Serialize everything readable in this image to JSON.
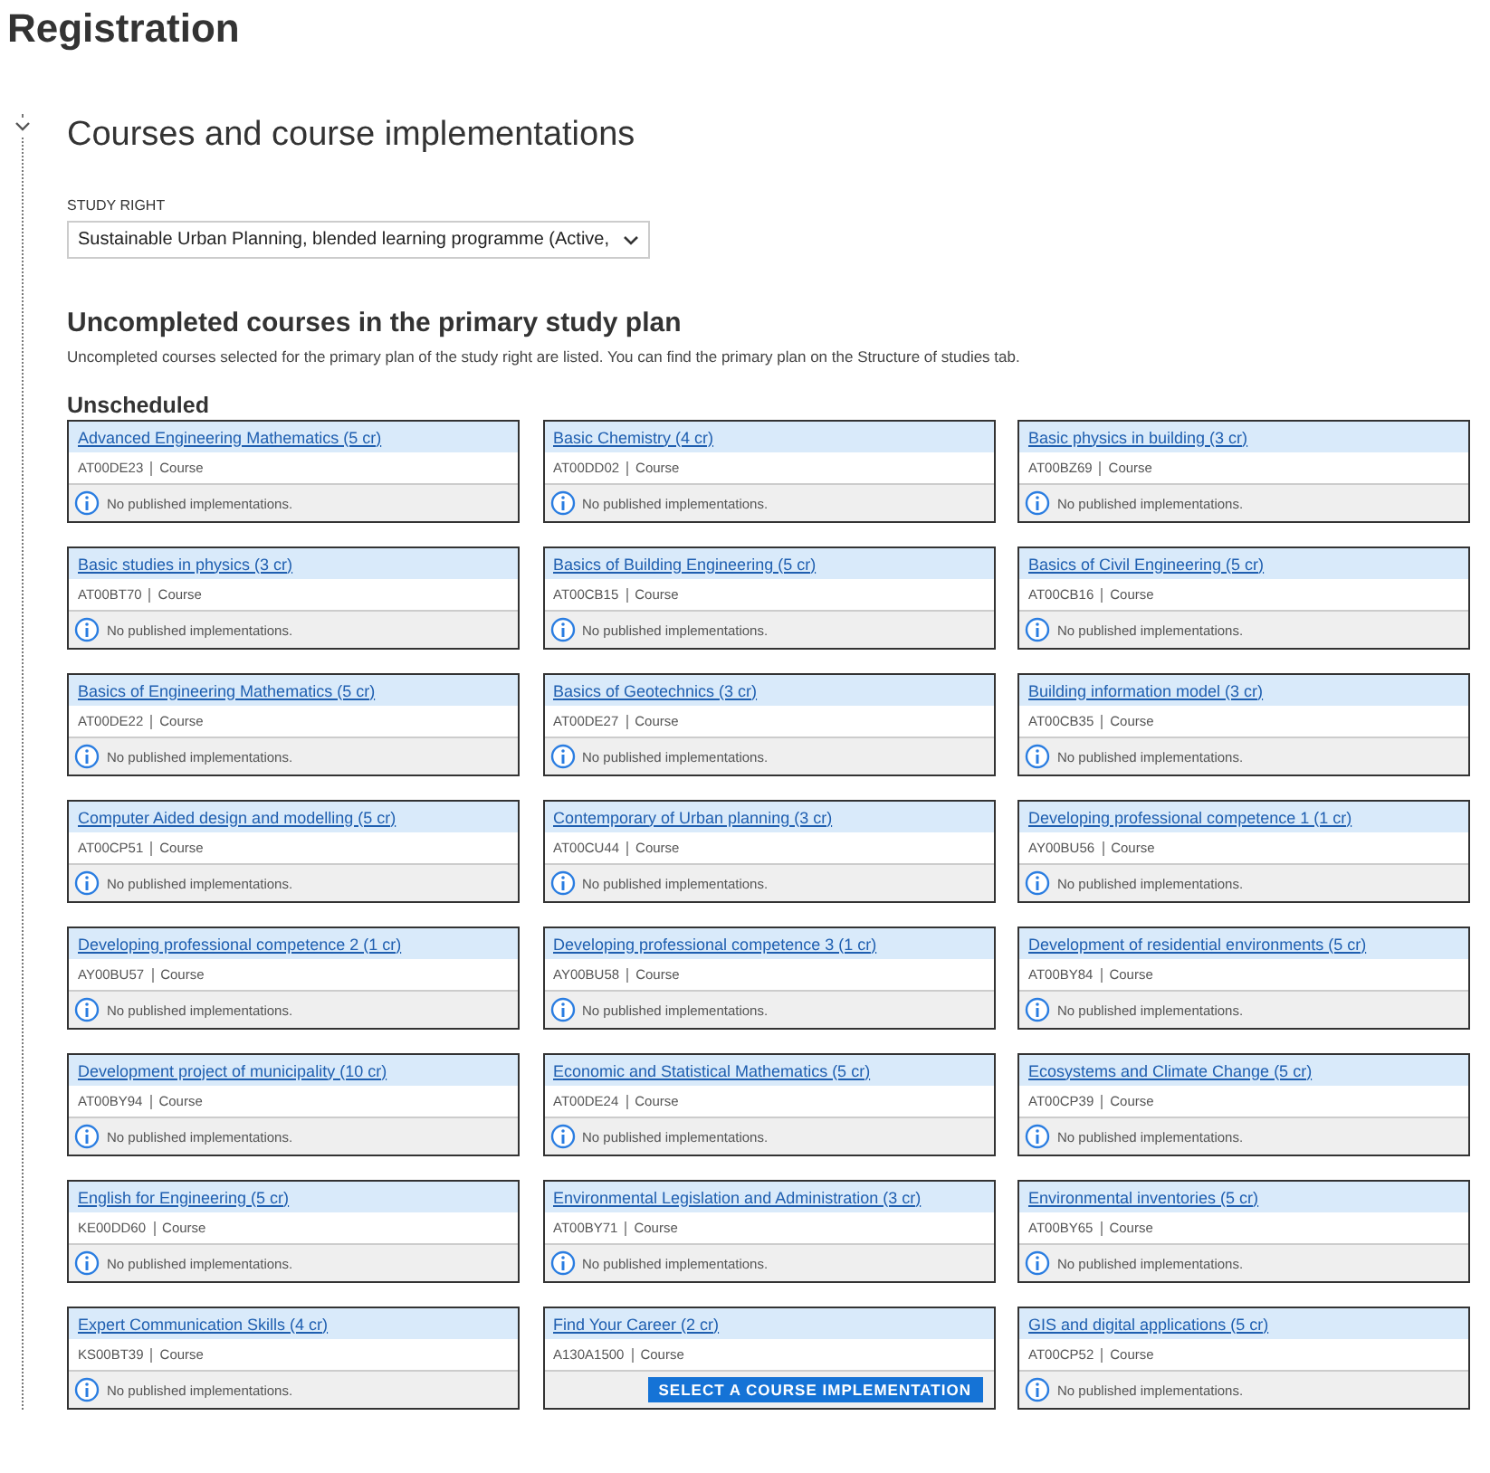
{
  "page_title": "Registration",
  "section": {
    "title": "Courses and course implementations",
    "expanded": true
  },
  "study_right": {
    "label": "STUDY RIGHT",
    "value": "Sustainable Urban Planning, blended learning programme (Active,"
  },
  "plan": {
    "title": "Uncompleted courses in the primary study plan",
    "description": "Uncompleted courses selected for the primary plan of the study right are listed. You can find the primary plan on the Structure of studies tab.",
    "group": "Unscheduled"
  },
  "courses": [
    {
      "title": "Advanced Engineering Mathematics (5 cr)",
      "code": "AT00DE23",
      "type": "Course",
      "kind": "info",
      "footer": "No published implementations."
    },
    {
      "title": "Basic Chemistry (4 cr)",
      "code": "AT00DD02",
      "type": "Course",
      "kind": "info",
      "footer": "No published implementations."
    },
    {
      "title": "Basic physics in building (3 cr)",
      "code": "AT00BZ69",
      "type": "Course",
      "kind": "info",
      "footer": "No published implementations."
    },
    {
      "title": "Basic studies in physics (3 cr)",
      "code": "AT00BT70",
      "type": "Course",
      "kind": "info",
      "footer": "No published implementations."
    },
    {
      "title": "Basics of Building Engineering (5 cr)",
      "code": "AT00CB15",
      "type": "Course",
      "kind": "info",
      "footer": "No published implementations."
    },
    {
      "title": "Basics of Civil Engineering (5 cr)",
      "code": "AT00CB16",
      "type": "Course",
      "kind": "info",
      "footer": "No published implementations."
    },
    {
      "title": "Basics of Engineering Mathematics (5 cr)",
      "code": "AT00DE22",
      "type": "Course",
      "kind": "info",
      "footer": "No published implementations."
    },
    {
      "title": "Basics of Geotechnics (3 cr)",
      "code": "AT00DE27",
      "type": "Course",
      "kind": "info",
      "footer": "No published implementations."
    },
    {
      "title": "Building information model (3 cr)",
      "code": "AT00CB35",
      "type": "Course",
      "kind": "info",
      "footer": "No published implementations."
    },
    {
      "title": "Computer Aided design and modelling (5 cr)",
      "code": "AT00CP51",
      "type": "Course",
      "kind": "info",
      "footer": "No published implementations."
    },
    {
      "title": "Contemporary of Urban planning (3 cr)",
      "code": "AT00CU44",
      "type": "Course",
      "kind": "info",
      "footer": "No published implementations."
    },
    {
      "title": "Developing professional competence 1 (1 cr)",
      "code": "AY00BU56",
      "type": "Course",
      "kind": "info",
      "footer": "No published implementations."
    },
    {
      "title": "Developing professional competence 2 (1 cr)",
      "code": "AY00BU57",
      "type": "Course",
      "kind": "info",
      "footer": "No published implementations."
    },
    {
      "title": "Developing professional competence 3 (1 cr)",
      "code": "AY00BU58",
      "type": "Course",
      "kind": "info",
      "footer": "No published implementations."
    },
    {
      "title": "Development of residential environments (5 cr)",
      "code": "AT00BY84",
      "type": "Course",
      "kind": "info",
      "footer": "No published implementations."
    },
    {
      "title": "Development project of municipality (10 cr)",
      "code": "AT00BY94",
      "type": "Course",
      "kind": "info",
      "footer": "No published implementations."
    },
    {
      "title": "Economic and Statistical Mathematics (5 cr)",
      "code": "AT00DE24",
      "type": "Course",
      "kind": "info",
      "footer": "No published implementations."
    },
    {
      "title": "Ecosystems and Climate Change (5 cr)",
      "code": "AT00CP39",
      "type": "Course",
      "kind": "info",
      "footer": "No published implementations."
    },
    {
      "title": "English for Engineering (5 cr)",
      "code": "KE00DD60",
      "type": "Course",
      "kind": "info",
      "footer": "No published implementations."
    },
    {
      "title": "Environmental Legislation and Administration (3 cr)",
      "code": "AT00BY71",
      "type": "Course",
      "kind": "info",
      "footer": "No published implementations."
    },
    {
      "title": "Environmental inventories (5 cr)",
      "code": "AT00BY65",
      "type": "Course",
      "kind": "info",
      "footer": "No published implementations."
    },
    {
      "title": "Expert Communication Skills (4 cr)",
      "code": "KS00BT39",
      "type": "Course",
      "kind": "info",
      "footer": "No published implementations."
    },
    {
      "title": "Find Your Career (2 cr)",
      "code": "A130A1500",
      "type": "Course",
      "kind": "action",
      "footer": "SELECT A COURSE IMPLEMENTATION"
    },
    {
      "title": "GIS and digital applications (5 cr)",
      "code": "AT00CP52",
      "type": "Course",
      "kind": "info",
      "footer": "No published implementations."
    }
  ]
}
